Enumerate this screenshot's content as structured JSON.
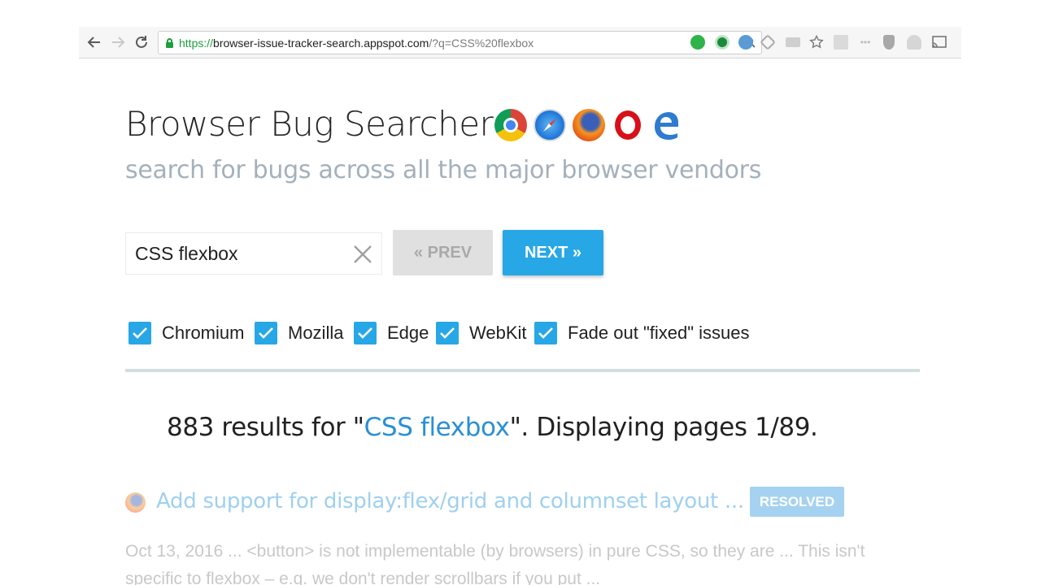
{
  "browser": {
    "url_scheme": "https://",
    "url_host": "browser-issue-tracker-search.appspot.com",
    "url_path": "/?q=CSS%20flexbox"
  },
  "page": {
    "title": "Browser Bug Searcher",
    "subtitle": "search for bugs across all the major browser vendors",
    "logos": [
      "chrome-logo",
      "safari-logo",
      "firefox-logo",
      "opera-logo",
      "edge-logo"
    ]
  },
  "search": {
    "value": "CSS flexbox",
    "prev_label": "« PREV",
    "next_label": "NEXT »"
  },
  "filters": [
    {
      "label": "Chromium",
      "checked": true
    },
    {
      "label": "Mozilla",
      "checked": true
    },
    {
      "label": "Edge",
      "checked": true
    },
    {
      "label": "WebKit",
      "checked": true
    },
    {
      "label": "Fade out \"fixed\" issues",
      "checked": true
    }
  ],
  "results": {
    "count_prefix": "883 results for \"",
    "query": "CSS flexbox",
    "count_suffix": "\". Displaying pages 1/89.",
    "items": [
      {
        "title": "Add support for display:flex/grid and columnset layout ...",
        "status": "RESOLVED",
        "browser_icon": "firefox-icon",
        "snippet": "Oct 13, 2016 ... <button> is not implementable (by browsers) in pure CSS, so they are ... This isn't specific to flexbox – e.g. we don't render scrollbars if you put ..."
      }
    ]
  },
  "colors": {
    "accent": "#27a7e6",
    "link": "#2a8fd6",
    "subtitle": "#a4b1bb"
  }
}
